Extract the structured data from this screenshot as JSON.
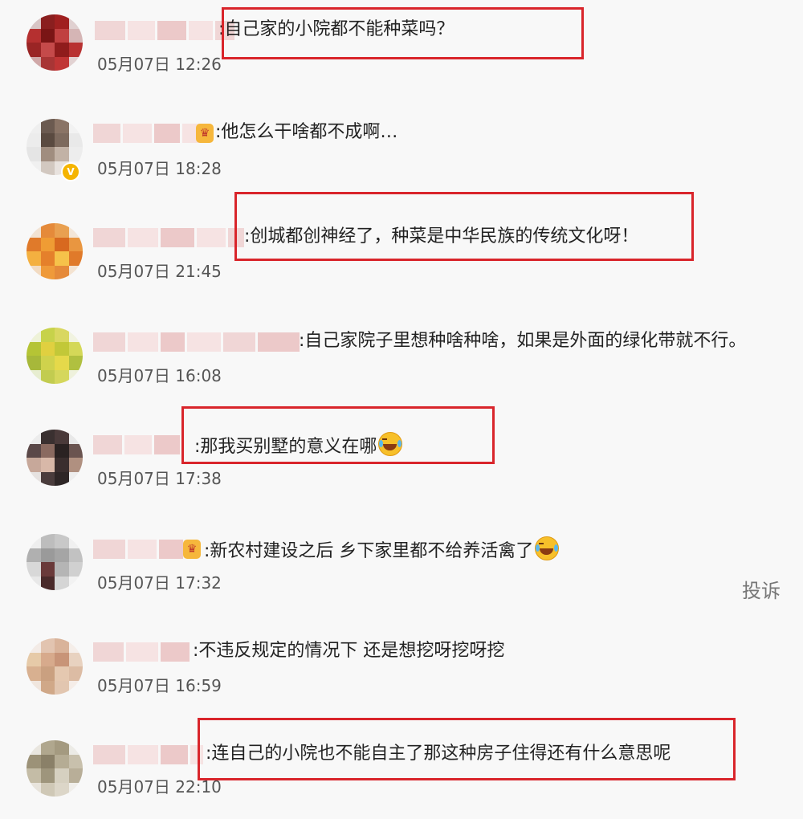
{
  "report_label": "投诉",
  "comments": [
    {
      "separator": ":",
      "text": "自己家的小院都不能种菜吗？",
      "time": "05月07日 12:26",
      "highlighted": true,
      "emoji": false
    },
    {
      "separator": ":",
      "text": "他怎么干啥都不成啊…",
      "time": "05月07日 18:28",
      "highlighted": false,
      "emoji": false
    },
    {
      "separator": ":",
      "text": "创城都创神经了，种菜是中华民族的传统文化呀！",
      "time": "05月07日 21:45",
      "highlighted": true,
      "emoji": false
    },
    {
      "separator": ":",
      "text": "自己家院子里想种啥种啥，如果是外面的绿化带就不行。",
      "time": "05月07日 16:08",
      "highlighted": false,
      "emoji": false
    },
    {
      "separator": ":",
      "text": "那我买别墅的意义在哪",
      "time": "05月07日 17:38",
      "highlighted": true,
      "emoji": true
    },
    {
      "separator": ":",
      "text": "新农村建设之后 乡下家里都不给养活禽了",
      "time": "05月07日 17:32",
      "highlighted": false,
      "emoji": true
    },
    {
      "separator": ":",
      "text": "不违反规定的情况下 还是想挖呀挖呀挖",
      "time": "05月07日 16:59",
      "highlighted": false,
      "emoji": false
    },
    {
      "separator": ":",
      "text": "连自己的小院也不能自主了那这种房子住得还有什么意思呢",
      "time": "05月07日 22:10",
      "highlighted": true,
      "emoji": false
    }
  ],
  "colors": {
    "highlight_border": "#d9252b",
    "background": "#f8f8f8",
    "text": "#222222",
    "timestamp": "#555555"
  },
  "icons": {
    "emoji": "laughing-crying-emoji-icon",
    "verified": "verified-badge-icon",
    "level": "user-level-icon"
  }
}
